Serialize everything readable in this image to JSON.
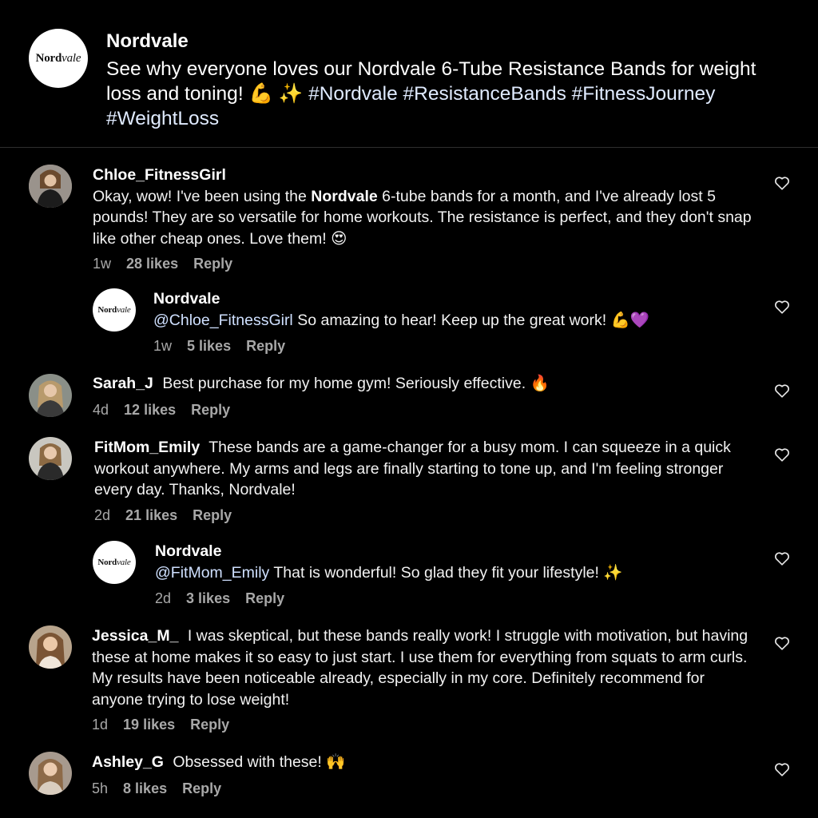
{
  "post": {
    "username": "Nordvale",
    "caption_text": "See why everyone loves our Nordvale 6-Tube Resistance Bands for weight loss and toning!",
    "caption_emojis": "💪 ✨",
    "hashtags": "#Nordvale #ResistanceBands #FitnessJourney #WeightLoss",
    "logo_a": "Nord",
    "logo_b": "vale"
  },
  "comments": [
    {
      "username": "Chloe_FitnessGirl",
      "text_a": "Okay, wow! I've been using the",
      "text_bold": "Nordvale",
      "text_b": "6-tube bands for a month, and I've already lost 5 pounds! They are so versatile for home workouts. The resistance is perfect, and they don't snap like other cheap ones. Love them! 😍",
      "time": "1w",
      "likes": "28 likes",
      "reply": "Reply"
    },
    {
      "username": "Nordvale",
      "mention": "@Chloe_FitnessGirl",
      "text": "So amazing to hear! Keep up the great work! 💪💜",
      "time": "1w",
      "likes": "5 likes",
      "reply": "Reply"
    },
    {
      "username": "Sarah_J",
      "text": "Best purchase for my home gym! Seriously effective. 🔥",
      "time": "4d",
      "likes": "12 likes",
      "reply": "Reply"
    },
    {
      "username": "FitMom_Emily",
      "text": "These bands are a game-changer for a busy mom. I can squeeze in a quick workout anywhere. My arms and legs are finally starting to tone up, and I'm feeling stronger every day. Thanks, Nordvale!",
      "time": "2d",
      "likes": "21 likes",
      "reply": "Reply"
    },
    {
      "username": "Nordvale",
      "mention": "@FitMom_Emily",
      "text": "That is wonderful! So glad they fit your lifestyle! ✨",
      "time": "2d",
      "likes": "3 likes",
      "reply": "Reply"
    },
    {
      "username": "Jessica_M_",
      "text": "I was skeptical, but these bands really work! I struggle with motivation, but having these at home makes it so easy to just start. I use them for everything from squats to arm curls. My results have been noticeable already, especially in my core. Definitely recommend for anyone trying to lose weight!",
      "time": "1d",
      "likes": "19 likes",
      "reply": "Reply"
    },
    {
      "username": "Ashley_G",
      "text": "Obsessed with these! 🙌",
      "time": "5h",
      "likes": "8 likes",
      "reply": "Reply"
    }
  ],
  "colors": {
    "background": "#000000",
    "text": "#f5f5f5",
    "meta": "#a8a8a8",
    "mention": "#cfe0ff",
    "hashtag": "#e0ebff"
  },
  "icons": {
    "like": "heart-outline-icon",
    "avatar_user": "avatar-photo",
    "avatar_brand": "nordvale-logo"
  }
}
